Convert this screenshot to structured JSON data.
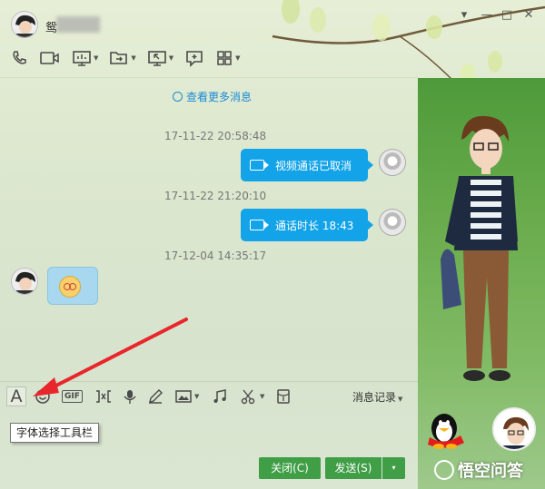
{
  "window": {
    "contact_name": "鸳",
    "controls": [
      "▾",
      "—",
      "□",
      "✕"
    ]
  },
  "toolbar": {
    "icons": [
      "phone-icon",
      "video-call-icon",
      "screen-share-icon",
      "file-transfer-icon",
      "remote-desktop-icon",
      "new-discussion-icon",
      "app-grid-icon"
    ]
  },
  "chat": {
    "more_messages": "查看更多消息",
    "messages": [
      {
        "time": "17-11-22 20:58:48",
        "text": "视频通话已取消"
      },
      {
        "time": "17-11-22 21:20:10",
        "text": "通话时长 18:43"
      },
      {
        "time": "17-12-04 14:35:17",
        "text": ""
      }
    ]
  },
  "input_toolbar": {
    "font_label": "A",
    "gif_label": "GIF",
    "history": "消息记录",
    "tooltip": "字体选择工具栏"
  },
  "buttons": {
    "close": "关闭(C)",
    "send": "发送(S)",
    "send_dropdown": "▾"
  },
  "watermark": "悟空问答",
  "colors": {
    "accent_blue": "#12a3e8",
    "button_green": "#3f9e46",
    "arrow_red": "#e8262b"
  }
}
